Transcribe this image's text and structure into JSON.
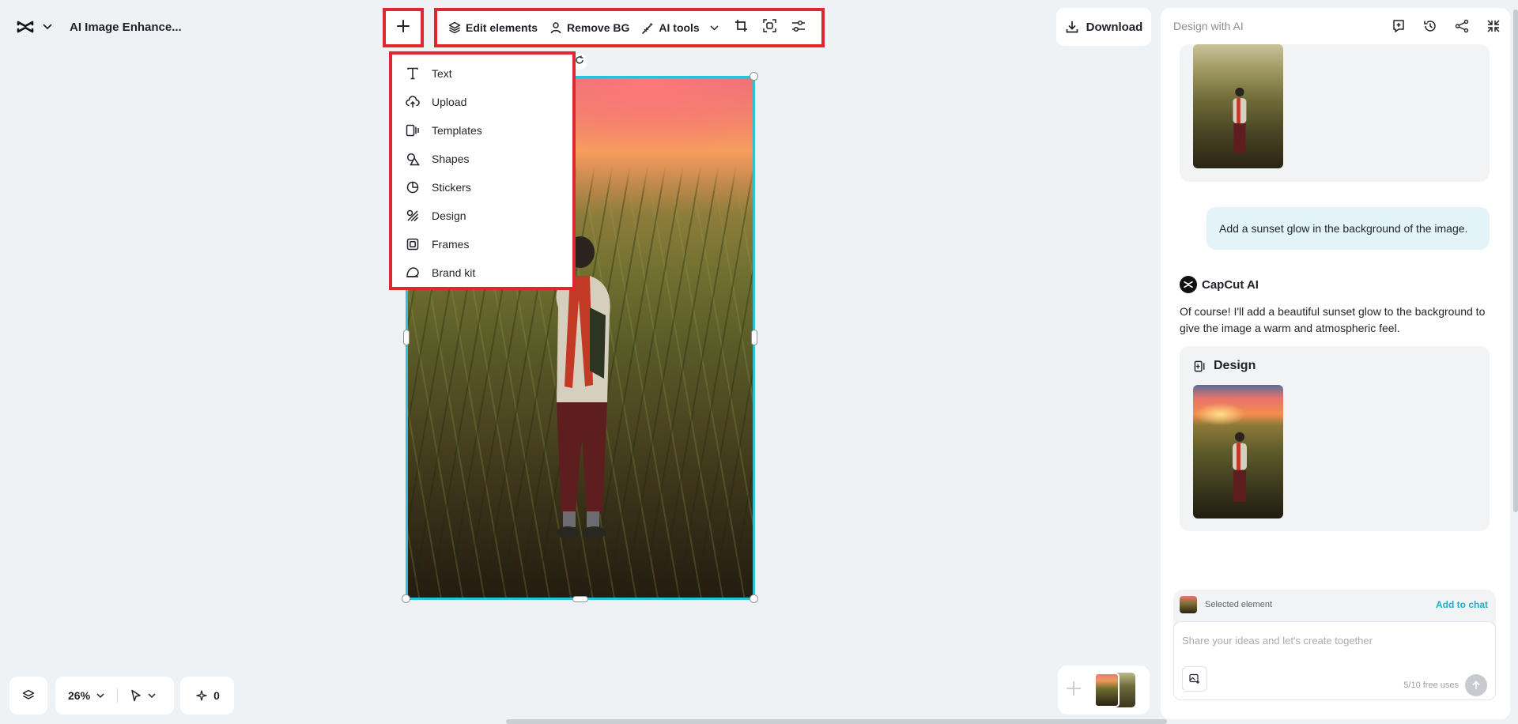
{
  "app": {
    "project_title": "AI Image Enhance..."
  },
  "toolbar": {
    "edit_elements": "Edit elements",
    "remove_bg": "Remove BG",
    "ai_tools": "AI tools"
  },
  "download": {
    "label": "Download"
  },
  "add_menu": {
    "items": [
      {
        "label": "Text",
        "icon": "text-icon"
      },
      {
        "label": "Upload",
        "icon": "upload-icon"
      },
      {
        "label": "Templates",
        "icon": "templates-icon"
      },
      {
        "label": "Shapes",
        "icon": "shapes-icon"
      },
      {
        "label": "Stickers",
        "icon": "stickers-icon"
      },
      {
        "label": "Design",
        "icon": "design-icon"
      },
      {
        "label": "Frames",
        "icon": "frames-icon"
      },
      {
        "label": "Brand kit",
        "icon": "brand-kit-icon"
      }
    ]
  },
  "bottom_bar": {
    "zoom": "26%",
    "ai_count": "0"
  },
  "panel": {
    "title": "Design with AI",
    "user_message": "Add a sunset glow in the background of the image.",
    "assistant_name": "CapCut AI",
    "assistant_message": "Of course! I'll add a beautiful sunset glow to the background to give the image a warm and atmospheric feel.",
    "design_card_title": "Design",
    "selected_element_label": "Selected element",
    "add_to_chat": "Add to chat",
    "input_placeholder": "Share your ideas and let's create together",
    "free_uses": "5/10 free uses"
  },
  "colors": {
    "highlight": "#e0262f",
    "selection": "#29c2d6",
    "accent": "#1ab1c8",
    "user_bubble": "#e2f4f7"
  }
}
